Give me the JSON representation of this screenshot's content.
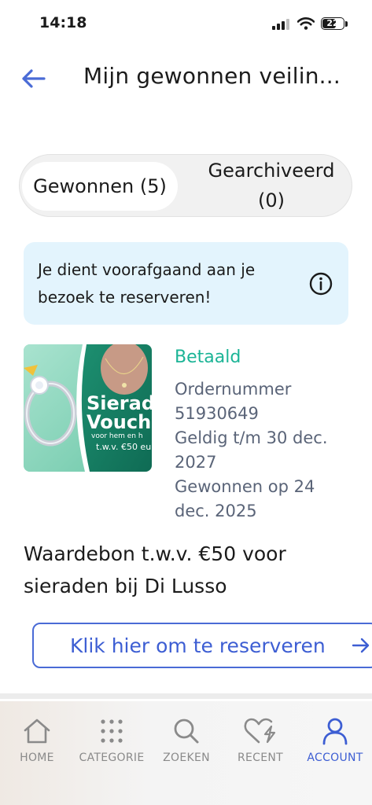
{
  "status_bar": {
    "time": "14:18",
    "battery": "22"
  },
  "header": {
    "title": "Mijn gewonnen veilin..."
  },
  "tabs": [
    {
      "label": "Gewonnen (5)",
      "active": true
    },
    {
      "label_line1": "Gearchiveerd",
      "label_line2": "(0)",
      "active": false
    }
  ],
  "info_banner": {
    "text": "Je dient voorafgaand aan je bezoek te reserveren!",
    "icon": "info-icon"
  },
  "voucher": {
    "image_text": {
      "line1": "Sierad",
      "line2": "Vouch",
      "line3": "voor hem en h",
      "line4": "t.w.v. €50 eu"
    },
    "status": "Betaald",
    "order_label": "Ordernummer",
    "order_number": "51930649",
    "valid_until": "Geldig t/m 30 dec. 2027",
    "won_on": "Gewonnen op 24 dec. 2025",
    "title": "Waardebon t.w.v. €50 voor sieraden bij Di Lusso",
    "reserve_button": "Klik hier om te reserveren"
  },
  "colors": {
    "accent": "#3d5ed3",
    "paid": "#1bb496",
    "banner": "#e3f4fd"
  },
  "nav": [
    {
      "label": "HOME",
      "icon": "home-icon"
    },
    {
      "label": "CATEGORIE",
      "icon": "grid-icon"
    },
    {
      "label": "ZOEKEN",
      "icon": "search-icon"
    },
    {
      "label": "RECENT",
      "icon": "heart-bolt-icon"
    },
    {
      "label": "ACCOUNT",
      "icon": "user-icon",
      "active": true
    }
  ]
}
